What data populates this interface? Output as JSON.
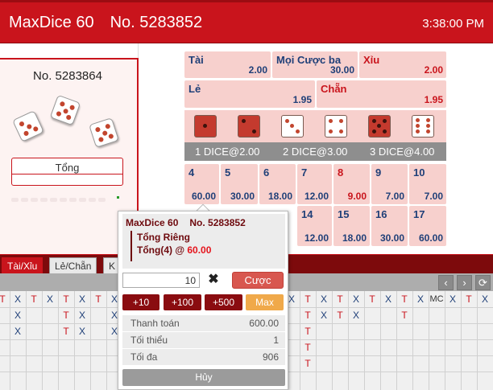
{
  "header": {
    "game_name": "MaxDice 60",
    "round_no": "No. 5283852",
    "time": "3:38:00 PM"
  },
  "left_panel": {
    "round_no": "No. 5283864",
    "total_label": "Tổng"
  },
  "bet_top": [
    {
      "name": "Tài",
      "odds": "2.00"
    },
    {
      "name": "Mọi Cược ba",
      "odds": "30.00"
    },
    {
      "name": "Xỉu",
      "odds": "2.00"
    },
    {
      "name": "Lẻ",
      "odds": "1.95"
    },
    {
      "name": "Chẵn",
      "odds": "1.95"
    }
  ],
  "dice_bar": [
    "1 DICE@2.00",
    "2 DICE@3.00",
    "3 DICE@4.00"
  ],
  "totals": [
    {
      "num": "4",
      "odds": "60.00"
    },
    {
      "num": "5",
      "odds": "30.00"
    },
    {
      "num": "6",
      "odds": "18.00"
    },
    {
      "num": "7",
      "odds": "12.00"
    },
    {
      "num": "8",
      "odds": "9.00"
    },
    {
      "num": "9",
      "odds": "7.00"
    },
    {
      "num": "10",
      "odds": "7.00"
    },
    {
      "num": "14",
      "odds": "12.00"
    },
    {
      "num": "15",
      "odds": "18.00"
    },
    {
      "num": "16",
      "odds": "30.00"
    },
    {
      "num": "17",
      "odds": "60.00"
    }
  ],
  "tabs": [
    "Tài/Xỉu",
    "Lẻ/Chẵn",
    "K"
  ],
  "nav": {
    "prev": "‹",
    "next": "›",
    "refresh": "⟳"
  },
  "history": {
    "row1": [
      "T",
      "X",
      "T",
      "X",
      "T",
      "X",
      "T",
      "X",
      "T"
    ],
    "row1_right": [
      "X",
      "T",
      "X",
      "T",
      "X",
      "T",
      "X",
      "T",
      "X",
      "MC",
      "X",
      "T",
      "X"
    ],
    "row2": [
      "X",
      "T",
      "X",
      "X"
    ],
    "row2_right": [
      "T",
      "X",
      "T",
      "X",
      "T"
    ],
    "row3": [
      "X",
      "T",
      "X",
      "X"
    ],
    "row3_right": [
      "T"
    ],
    "row4_right": [
      "T"
    ],
    "row5_right": [
      "T"
    ]
  },
  "popup": {
    "game_name": "MaxDice 60",
    "round_no": "No. 5283852",
    "bet_type": "Tổng Riêng",
    "bet_selection": "Tổng(4) @ ",
    "bet_odds": "60.00",
    "amount": "10",
    "clear": "✖",
    "bet_button": "Cược",
    "increments": [
      "+10",
      "+100",
      "+500",
      "Max"
    ],
    "payout_label": "Thanh toán",
    "payout_value": "600.00",
    "min_label": "Tối thiểu",
    "min_value": "1",
    "max_label": "Tối đa",
    "max_value": "906",
    "cancel": "Hủy"
  },
  "colors": {
    "brand_red": "#c9141c",
    "cell_pink": "#f7d0cd",
    "odds_blue": "#1f3f78",
    "max_orange": "#f0a94a"
  }
}
